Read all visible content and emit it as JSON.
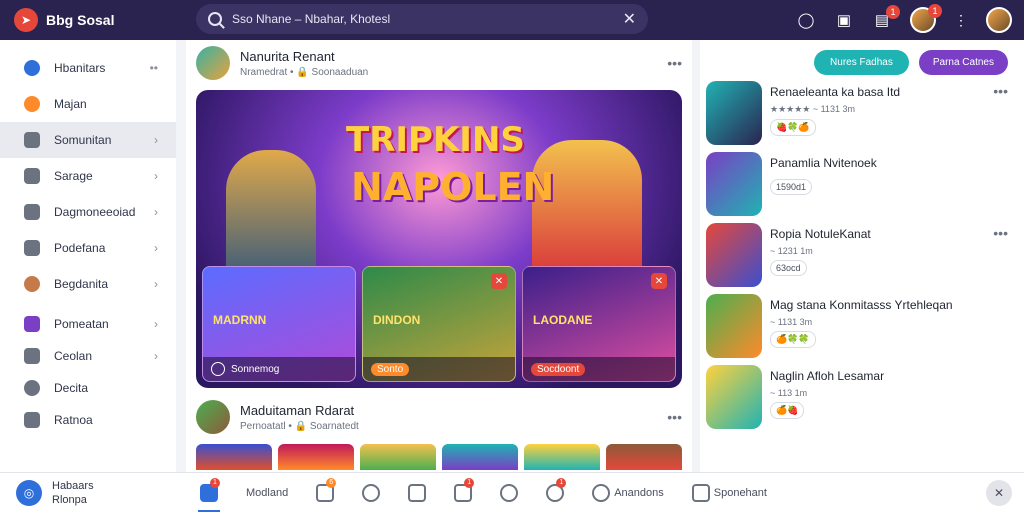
{
  "app": {
    "title": "Bbg Sosal"
  },
  "search": {
    "value": "Sso Nhane – Nbahar, Khotesl"
  },
  "top_badges": {
    "shop": "1",
    "notif": "1"
  },
  "sidebar": {
    "items": [
      {
        "label": "Hbanitars"
      },
      {
        "label": "Majan"
      },
      {
        "label": "Somunitan"
      },
      {
        "label": "Sarage"
      },
      {
        "label": "Dagmoneeoiad"
      },
      {
        "label": "Podefana"
      },
      {
        "label": "Begdanita"
      },
      {
        "label": "Pomeatan"
      },
      {
        "label": "Ceolan"
      },
      {
        "label": "Decita"
      },
      {
        "label": "Ratnoa"
      }
    ]
  },
  "feed": {
    "post1": {
      "author": "Nanurita Renant",
      "meta": "Nramedrat • 🔒 Soonaaduan",
      "hero_title": "TRIPKINS",
      "hero_subtitle": "NAPOLEN",
      "cards": [
        {
          "label": "MADRNN",
          "bar": "Sonnemog"
        },
        {
          "label": "DINDON",
          "bar": "Sonto"
        },
        {
          "label": "LAODANE",
          "bar": "Socdoont"
        }
      ]
    },
    "post2": {
      "author": "Maduitaman Rdarat",
      "meta": "Pernoatatl • 🔒 Soarnatedt"
    }
  },
  "right": {
    "btn_primary": "Nures Fadhas",
    "btn_secondary": "Parna Catnes",
    "items": [
      {
        "name": "Renaeleanta ka basa Itd",
        "meta": "★★★★★ ~ 1131 3m",
        "tag": "🍓🍀🍊"
      },
      {
        "name": "Panamlia Nvitenoek",
        "meta": "",
        "tag": "1590d1"
      },
      {
        "name": "Ropia NotuleKanat",
        "meta": "~ 1231 1m",
        "tag": "63ocd"
      },
      {
        "name": "Mag stana Konmitasss Yrtehleqan",
        "meta": "~ 1131 3m",
        "tag": "🍊🍀🍀"
      },
      {
        "name": "Naglin Afloh Lesamar",
        "meta": "~ 113 1m",
        "tag": "🍊🍓"
      }
    ]
  },
  "bottom": {
    "profile_line1": "Habaars",
    "profile_line2": "Rlonpa",
    "nav": [
      {
        "label": ""
      },
      {
        "label": "Modland"
      },
      {
        "label": ""
      },
      {
        "label": ""
      },
      {
        "label": ""
      },
      {
        "label": ""
      },
      {
        "label": ""
      },
      {
        "label": ""
      },
      {
        "label": "Anandons"
      },
      {
        "label": "Sponehant"
      }
    ]
  }
}
